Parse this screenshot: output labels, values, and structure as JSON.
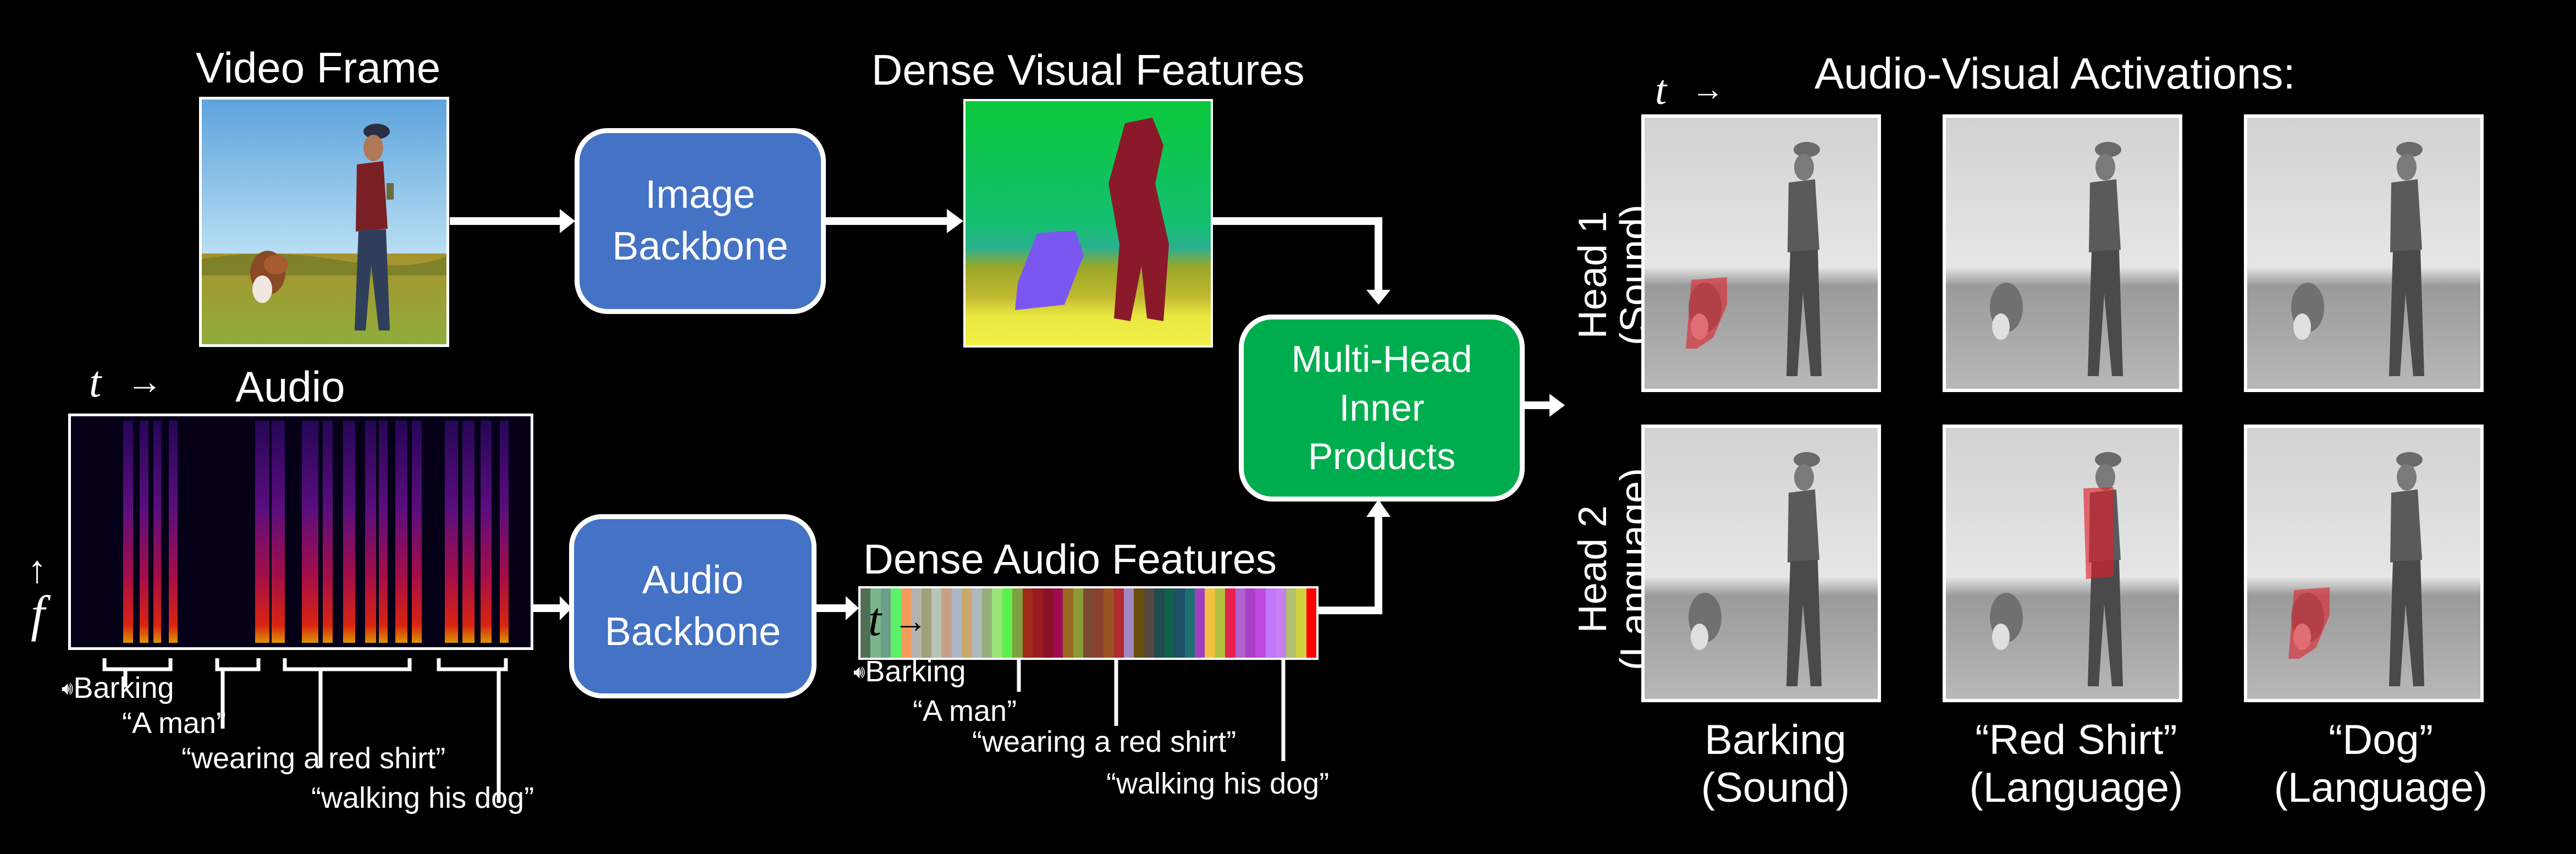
{
  "titles": {
    "video_frame": "Video Frame",
    "dense_visual": "Dense Visual Features",
    "audio": "Audio",
    "dense_audio": "Dense Audio Features",
    "activations": "Audio-Visual Activations:"
  },
  "axis_labels": {
    "time": "t",
    "time_arrow": "→",
    "freq": "f",
    "freq_arrow": "↑"
  },
  "boxes": {
    "image_backbone": [
      "Image",
      "Backbone"
    ],
    "audio_backbone": [
      "Audio",
      "Backbone"
    ],
    "inner_products": [
      "Multi-Head",
      "Inner",
      "Products"
    ]
  },
  "audio_annotations": [
    {
      "label": "Barking",
      "icon": "speaker-icon"
    },
    {
      "label": "“A man”"
    },
    {
      "label": "“wearing a red shirt”"
    },
    {
      "label": "“walking his dog”"
    }
  ],
  "feature_annotations": [
    {
      "label": "Barking",
      "icon": "speaker-icon"
    },
    {
      "label": "“A man”"
    },
    {
      "label": "“wearing a red shirt”"
    },
    {
      "label": "“walking his dog”"
    }
  ],
  "heads": [
    {
      "name": "Head 1",
      "type": "(Sound)"
    },
    {
      "name": "Head 2",
      "type": "(Language)"
    }
  ],
  "column_captions": [
    {
      "line1": "Barking",
      "line2": "(Sound)"
    },
    {
      "line1": "“Red Shirt”",
      "line2": "(Language)"
    },
    {
      "line1": "“Dog”",
      "line2": "(Language)"
    }
  ],
  "activation_grid": [
    [
      {
        "target": "dog",
        "strength": 0.8
      },
      {
        "target": "none",
        "strength": 0.0
      },
      {
        "target": "none",
        "strength": 0.05
      }
    ],
    [
      {
        "target": "none",
        "strength": 0.02
      },
      {
        "target": "shirt",
        "strength": 0.85
      },
      {
        "target": "dog",
        "strength": 0.8
      }
    ]
  ],
  "colors": {
    "background": "#000000",
    "image_backbone": "#4472c4",
    "audio_backbone": "#4472c4",
    "inner_products": "#00ad4e",
    "activation": "#e0202a"
  },
  "audio_feature_stripes": [
    "#4f6f55",
    "#7ab58a",
    "#6aa088",
    "#5ef068",
    "#f39a5c",
    "#b3b3b3",
    "#a0a07a",
    "#b6c4b6",
    "#c8a088",
    "#a9b7c9",
    "#c9a86a",
    "#b0b8c0",
    "#94b07a",
    "#9be47a",
    "#5ef04a",
    "#7ea040",
    "#a02a18",
    "#9a1a20",
    "#8c1028",
    "#a00a50",
    "#9a6a20",
    "#8a9a34",
    "#7c4a30",
    "#8e4030",
    "#9a5424",
    "#b02a30",
    "#a088c0",
    "#6a5010",
    "#544840",
    "#204c50",
    "#10604a",
    "#1e4e68",
    "#1e7070",
    "#a040c0",
    "#f0c040",
    "#b0c040",
    "#e82050",
    "#b060d0",
    "#a840c8",
    "#c048e0",
    "#c078f8",
    "#c880f0",
    "#b0c070",
    "#d0d040",
    "#ff0000"
  ]
}
